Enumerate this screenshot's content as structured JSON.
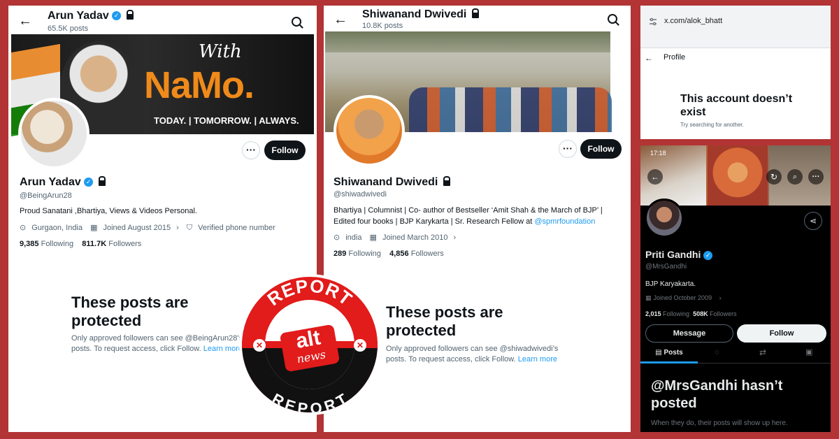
{
  "panel1": {
    "topbar_name": "Arun Yadav",
    "topbar_posts": "65.5K posts",
    "banner_with": "With",
    "banner_namo": "NaMo.",
    "banner_tagline": "TODAY. | TOMORROW. | ALWAYS.",
    "follow_label": "Follow",
    "more_label": "···",
    "name": "Arun Yadav",
    "handle": "@BeingArun28",
    "bio": "Proud Sanatani ,Bhartiya, Views & Videos Personal.",
    "location": "Gurgaon, India",
    "joined": "Joined August 2015",
    "verified_phone": "Verified phone number",
    "following_count": "9,385",
    "following_label": "Following",
    "followers_count": "811.7K",
    "followers_label": "Followers",
    "protected_title": "These posts are protected",
    "protected_text": "Only approved followers can see @BeingArun28's posts. To request access, click Follow.",
    "learn_more": "Learn more"
  },
  "panel2": {
    "topbar_name": "Shiwanand Dwivedi",
    "topbar_posts": "10.8K posts",
    "follow_label": "Follow",
    "more_label": "···",
    "name": "Shiwanand Dwivedi",
    "handle": "@shiwadwivedi",
    "bio": "Bhartiya | Columnist | Co- author of Bestseller ‘Amit Shah & the March of BJP’ | Edited four books | BJP Karykarta | Sr. Research Fellow at",
    "bio_link": "@spmrfoundation",
    "location": "india",
    "joined": "Joined March 2010",
    "following_count": "289",
    "following_label": "Following",
    "followers_count": "4,856",
    "followers_label": "Followers",
    "protected_title": "These posts are protected",
    "protected_text": "Only approved followers can see @shiwadwivedi’s posts. To request access, click Follow.",
    "learn_more": "Learn more"
  },
  "panel3": {
    "url": "x.com/alok_bhatt",
    "header": "Profile",
    "title": "This account doesn’t exist",
    "subtitle": "Try searching for another."
  },
  "panel4": {
    "status_time": "17:18",
    "name": "Priti Gandhi",
    "handle": "@MrsGandhi",
    "bio": "BJP Karyakarta.",
    "joined": "Joined October 2009",
    "following_count": "2,015",
    "following_label": "Following",
    "followers_count": "508K",
    "followers_label": "Followers",
    "message_label": "Message",
    "follow_label": "Follow",
    "tab_posts": "Posts",
    "empty_title": "@MrsGandhi hasn’t posted",
    "empty_text": "When they do, their posts will show up here."
  },
  "stamp": {
    "top": "REPORT",
    "bottom": "REPORT",
    "logo_alt": "alt",
    "logo_news": "news"
  },
  "colors": {
    "frame": "#b23434",
    "accent_blue": "#1d9bf0",
    "stamp_red": "#e21b1b"
  }
}
